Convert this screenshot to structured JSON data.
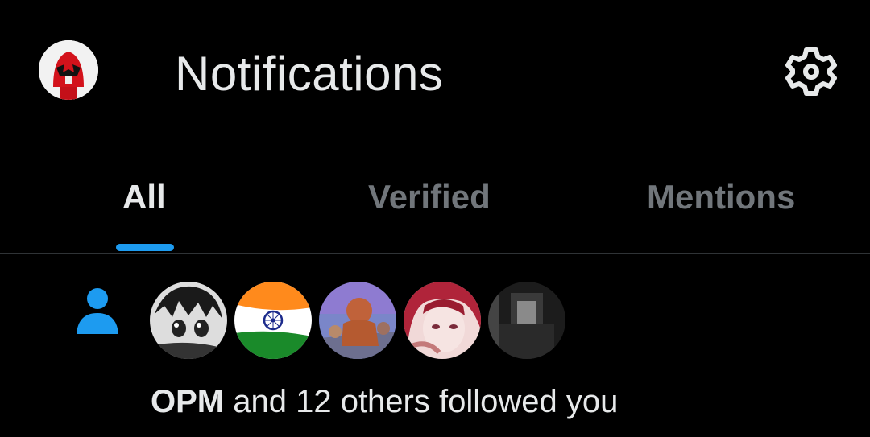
{
  "header": {
    "title": "Notifications",
    "profile_icon": "red-ranger-helmet-icon",
    "settings_icon": "gear-icon"
  },
  "tabs": [
    {
      "label": "All",
      "active": true
    },
    {
      "label": "Verified",
      "active": false
    },
    {
      "label": "Mentions",
      "active": false
    }
  ],
  "notification": {
    "type_icon": "person-icon",
    "actor": "OPM",
    "text": " and 12 others followed you",
    "avatars": [
      "manga-boy-avatar",
      "india-flag-avatar",
      "cartoon-pirate-avatar",
      "anime-girl-avatar",
      "grayscale-photo-avatar"
    ]
  },
  "colors": {
    "accent": "#1d9bf0",
    "text_primary": "#e7e9ea",
    "text_secondary": "#71767b",
    "background": "#000000"
  }
}
